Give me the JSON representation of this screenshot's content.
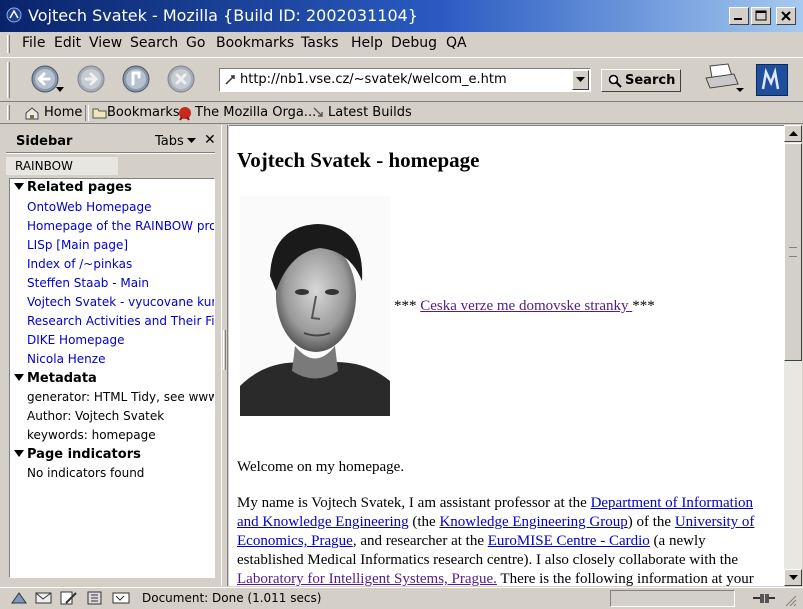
{
  "window": {
    "title": "Vojtech Svatek - Mozilla {Build ID: 2002031104}"
  },
  "menu": [
    "File",
    "Edit",
    "View",
    "Search",
    "Go",
    "Bookmarks",
    "Tasks",
    "Help",
    "Debug",
    "QA"
  ],
  "navigation": {
    "url": "http://nb1.vse.cz/~svatek/welcom_e.htm",
    "search_label": "Search"
  },
  "personal_toolbar": {
    "items": [
      "Home",
      "Bookmarks",
      "The Mozilla Orga...",
      "Latest Builds"
    ]
  },
  "sidebar": {
    "title": "Sidebar",
    "tabs_label": "Tabs",
    "close": "✕",
    "panel_tab": "RAINBOW",
    "sections": {
      "related": {
        "title": "Related pages",
        "links": [
          "OntoWeb Homepage",
          "Homepage of the RAINBOW proje",
          "LISp [Main page]",
          "Index of /~pinkas",
          "Steffen Staab - Main",
          "Vojtech Svatek - vyucovane kurzy",
          "Research Activities and Their Fin",
          "DIKE Homepage",
          "Nicola Henze"
        ]
      },
      "metadata": {
        "title": "Metadata",
        "items": [
          "generator: HTML Tidy, see www",
          "Author: Vojtech Svatek",
          "keywords: homepage"
        ]
      },
      "indicators": {
        "title": "Page indicators",
        "items": [
          "No indicators found"
        ]
      }
    }
  },
  "page": {
    "title": "Vojtech Svatek - homepage",
    "czech_prefix": "*** ",
    "czech_link": "Ceska verze me domovske stranky ",
    "czech_suffix": "***",
    "welcome": "Welcome on my homepage.",
    "para": {
      "t1": "My name is Vojtech Svatek, I am assistant professor at the ",
      "l1": "Department of Information and Knowledge Engineering",
      "t2": " (the ",
      "l2": "Knowledge Engineering Group",
      "t3": ") of the ",
      "l3": "University of Economics, Prague",
      "t4": ", and researcher at the ",
      "l4": "EuroMISE Centre - Cardio",
      "t5": " (a newly established Medical Informatics research centre). I also closely collaborate with the ",
      "l5": "Laboratory for Intelligent Systems, Prague.",
      "t6": " There is the following information at your"
    }
  },
  "status": {
    "text": "Document: Done (1.011 secs)"
  }
}
